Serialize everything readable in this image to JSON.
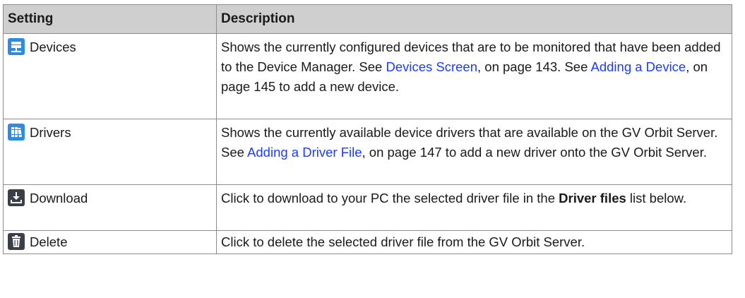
{
  "table": {
    "headers": {
      "setting": "Setting",
      "description": "Description"
    },
    "rows": {
      "devices": {
        "icon": "devices-icon",
        "setting": "Devices",
        "d1": "Shows the currently configured devices that are to be monitored that have been added to the Device Manager. See ",
        "link1": "Devices Screen",
        "d2": ", on page 143. See ",
        "link2": "Adding a Device",
        "d3": ", on page 145 to add a new device."
      },
      "drivers": {
        "icon": "drivers-icon",
        "setting": "Drivers",
        "d1": "Shows the currently available device drivers that are available on the GV Orbit Server. See ",
        "link1": "Adding a Driver File",
        "d2": ", on page 147 to add a new driver onto the GV Orbit Server."
      },
      "download": {
        "icon": "download-icon",
        "setting": "Download",
        "d1": "Click to download to your PC the selected driver file in the ",
        "bold1": "Driver files",
        "d2": " list below."
      },
      "delete": {
        "icon": "trash-icon",
        "setting": "Delete",
        "d1": "Click to delete the selected driver file from the GV Orbit Server."
      }
    }
  }
}
